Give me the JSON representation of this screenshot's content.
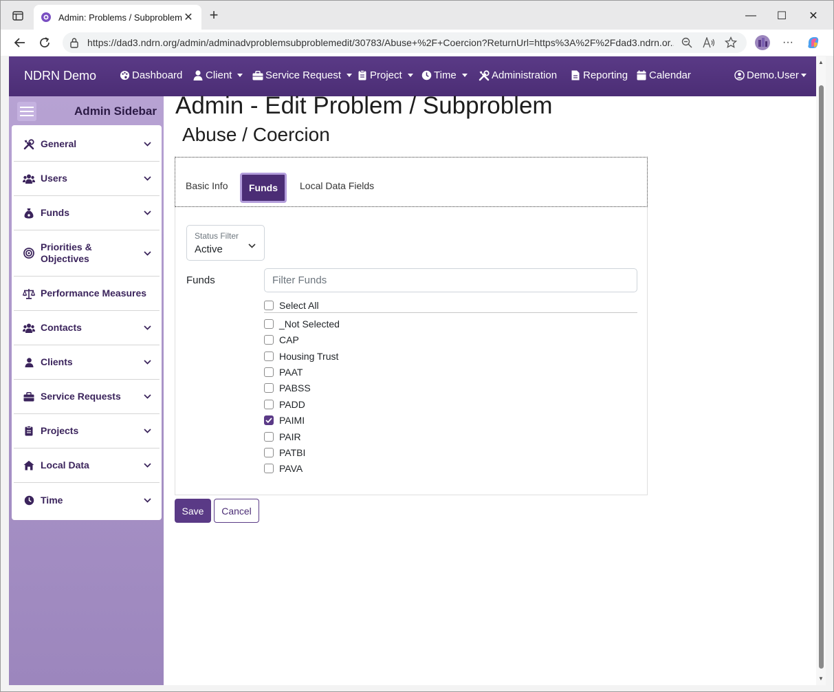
{
  "browser": {
    "tab_title": "Admin: Problems / Subproblems",
    "url": "https://dad3.ndrn.org/admin/adminadvproblemsubproblemedit/30783/Abuse+%2F+Coercion?ReturnUrl=https%3A%2F%2Fdad3.ndrn.or...",
    "new_tab_symbol": "+",
    "close_symbol": "✕",
    "min_symbol": "—",
    "max_symbol": "☐",
    "more_symbol": "···"
  },
  "navbar": {
    "brand": "NDRN Demo",
    "items": [
      {
        "label": "Dashboard",
        "icon": "palette-icon",
        "dropdown": false
      },
      {
        "label": "Client",
        "icon": "user-icon",
        "dropdown": true
      },
      {
        "label": "Service Request",
        "icon": "briefcase-icon",
        "dropdown": true
      },
      {
        "label": "Project",
        "icon": "clipboard-icon",
        "dropdown": true
      },
      {
        "label": "Time",
        "icon": "clock-icon",
        "dropdown": true
      },
      {
        "label": "Administration",
        "icon": "tools-icon",
        "dropdown": false
      },
      {
        "label": "Reporting",
        "icon": "file-icon",
        "dropdown": false
      },
      {
        "label": "Calendar",
        "icon": "calendar-icon",
        "dropdown": false
      }
    ],
    "user": "Demo.User"
  },
  "sidebar": {
    "title": "Admin Sidebar",
    "items": [
      {
        "label": "General",
        "icon": "tools-icon",
        "expandable": true
      },
      {
        "label": "Users",
        "icon": "users-icon",
        "expandable": true
      },
      {
        "label": "Funds",
        "icon": "money-bag-icon",
        "expandable": true
      },
      {
        "label": "Priorities & Objectives",
        "icon": "target-icon",
        "expandable": true
      },
      {
        "label": "Performance Measures",
        "icon": "scale-icon",
        "expandable": false
      },
      {
        "label": "Contacts",
        "icon": "users-icon",
        "expandable": true
      },
      {
        "label": "Clients",
        "icon": "user-icon",
        "expandable": true
      },
      {
        "label": "Service Requests",
        "icon": "briefcase-icon",
        "expandable": true
      },
      {
        "label": "Projects",
        "icon": "clipboard-icon",
        "expandable": true
      },
      {
        "label": "Local Data",
        "icon": "house-icon",
        "expandable": true
      },
      {
        "label": "Time",
        "icon": "clock-icon",
        "expandable": true
      }
    ]
  },
  "page": {
    "title": "Admin - Edit Problem / Subproblem",
    "subtitle": "Abuse / Coercion",
    "tabs": [
      "Basic Info",
      "Funds",
      "Local Data Fields"
    ],
    "active_tab": "Funds",
    "status_filter": {
      "label": "Status Filter",
      "value": "Active"
    },
    "funds_label": "Funds",
    "filter_placeholder": "Filter Funds",
    "select_all": "Select All",
    "funds": [
      {
        "name": "_Not Selected",
        "checked": false
      },
      {
        "name": "CAP",
        "checked": false
      },
      {
        "name": "Housing Trust",
        "checked": false
      },
      {
        "name": "PAAT",
        "checked": false
      },
      {
        "name": "PABSS",
        "checked": false
      },
      {
        "name": "PADD",
        "checked": false
      },
      {
        "name": "PAIMI",
        "checked": true
      },
      {
        "name": "PAIR",
        "checked": false
      },
      {
        "name": "PATBI",
        "checked": false
      },
      {
        "name": "PAVA",
        "checked": false
      }
    ],
    "save_label": "Save",
    "cancel_label": "Cancel"
  },
  "colors": {
    "brand_purple": "#4b2d75",
    "sidebar_bg": "#b7a2d3",
    "checked_fill": "#5b3a87"
  }
}
